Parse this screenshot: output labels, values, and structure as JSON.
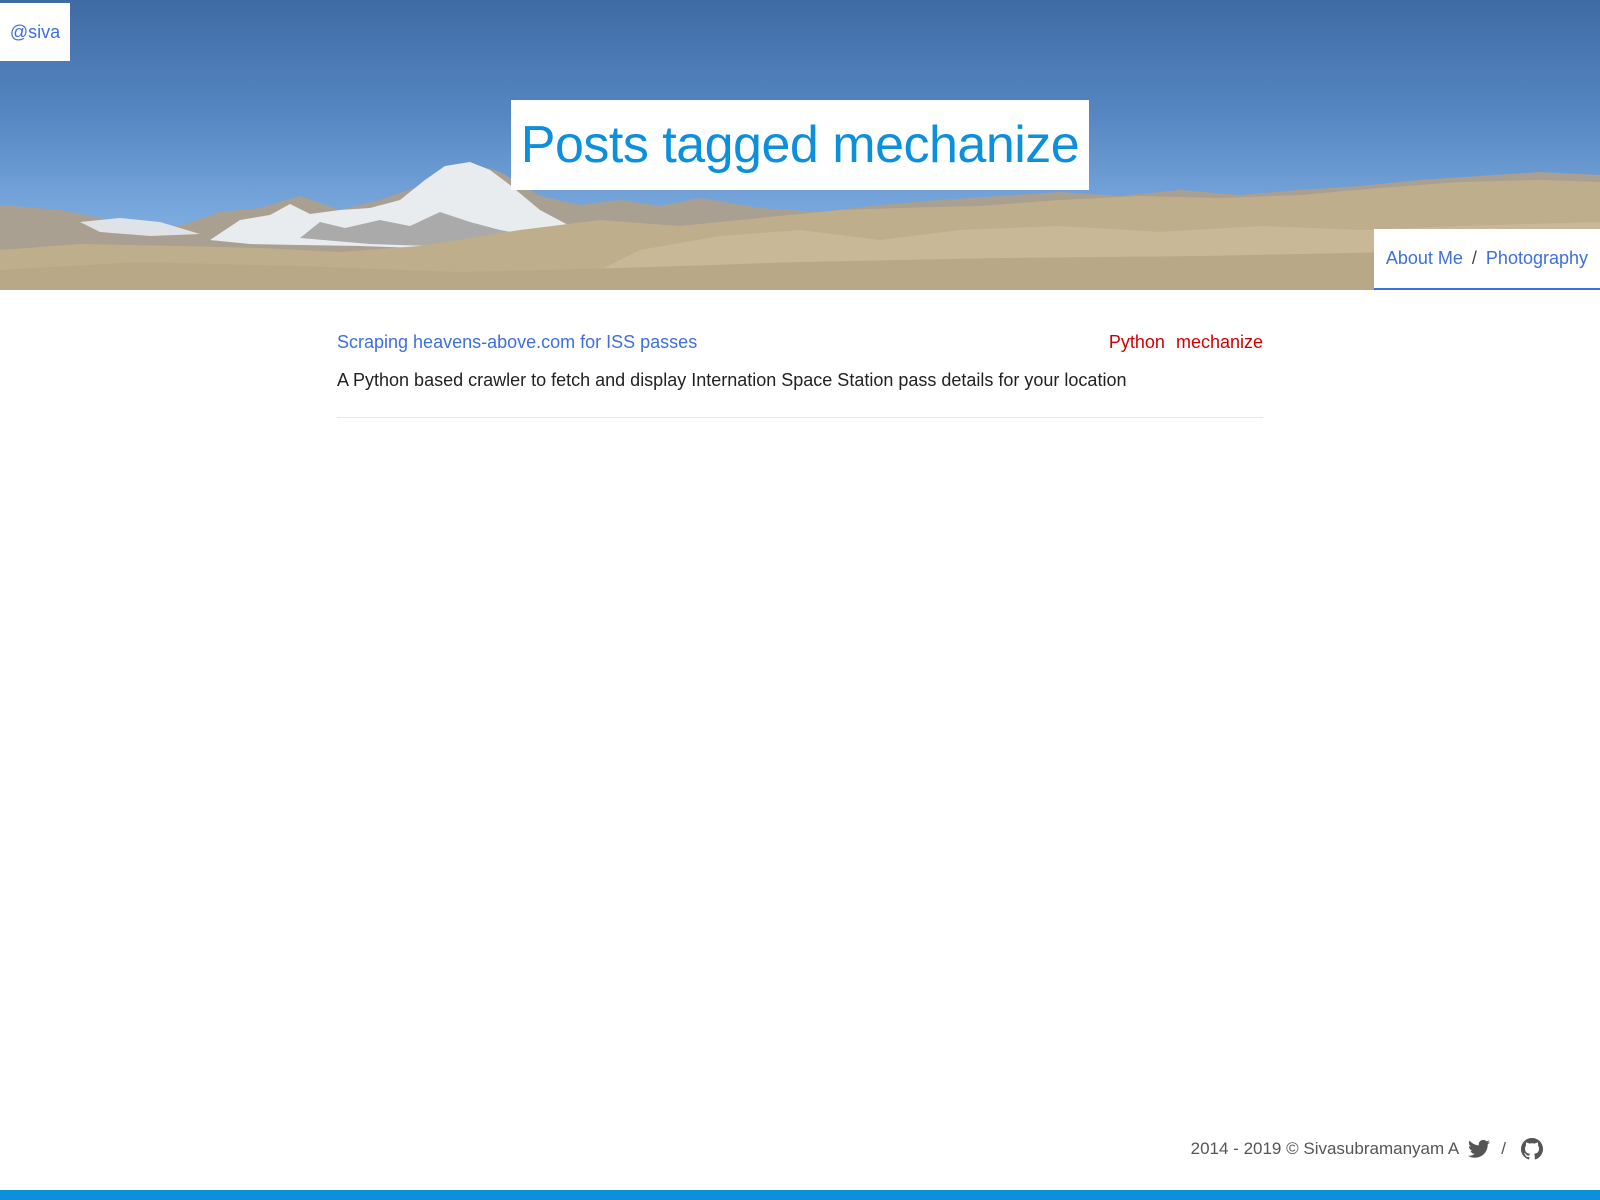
{
  "header": {
    "handle": "@siva",
    "title": "Posts tagged mechanize",
    "nav": {
      "items": [
        {
          "label": "About Me"
        },
        {
          "label": "Photography"
        }
      ],
      "separator": "/"
    }
  },
  "posts": [
    {
      "title": "Scraping heavens-above.com for ISS passes",
      "description": "A Python based crawler to fetch and display Internation Space Station pass details for your location",
      "tags": [
        "Python",
        "mechanize"
      ]
    }
  ],
  "footer": {
    "copyright": "2014 - 2019 © Sivasubramanyam A",
    "separator": "/",
    "icons": [
      "twitter-icon",
      "github-icon"
    ]
  },
  "colors": {
    "link": "#3d6fe0",
    "title": "#0c8fdd",
    "tag": "#d10000",
    "accent_bar": "#0c8fdd"
  }
}
